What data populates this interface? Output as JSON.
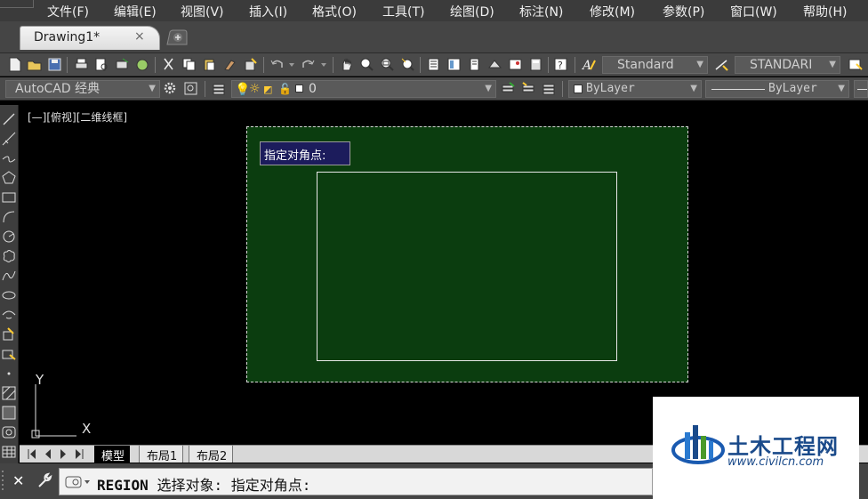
{
  "menu": {
    "items": [
      {
        "label": "文件(F)"
      },
      {
        "label": "编辑(E)"
      },
      {
        "label": "视图(V)"
      },
      {
        "label": "插入(I)"
      },
      {
        "label": "格式(O)"
      },
      {
        "label": "工具(T)"
      },
      {
        "label": "绘图(D)"
      },
      {
        "label": "标注(N)"
      },
      {
        "label": "修改(M)"
      },
      {
        "label": "参数(P)"
      },
      {
        "label": "窗口(W)"
      },
      {
        "label": "帮助(H)"
      }
    ]
  },
  "tabs": {
    "document": {
      "title": "Drawing1*",
      "close_glyph": "×"
    }
  },
  "toolbar1": {
    "text_style": "Standard",
    "dim_style": "STANDARI"
  },
  "toolbar2": {
    "workspace": "AutoCAD 经典",
    "layer": "0",
    "color": "ByLayer",
    "linetype": "ByLayer"
  },
  "viewport": {
    "label": "[—][俯视][二维线框]"
  },
  "canvas": {
    "tooltip": "指定对角点:",
    "colors": {
      "background": "#000000",
      "selection_fill": "#0b3d0f"
    }
  },
  "ucs": {
    "y_label": "Y",
    "x_label": "X"
  },
  "layout_tabs": [
    {
      "label": "模型",
      "active": true
    },
    {
      "label": "布局1",
      "active": false
    },
    {
      "label": "布局2",
      "active": false
    }
  ],
  "command": {
    "name": "REGION",
    "prompt": "选择对象: 指定对角点:"
  },
  "watermark": {
    "name": "土木工程网",
    "url": "www.civilcn.com"
  }
}
